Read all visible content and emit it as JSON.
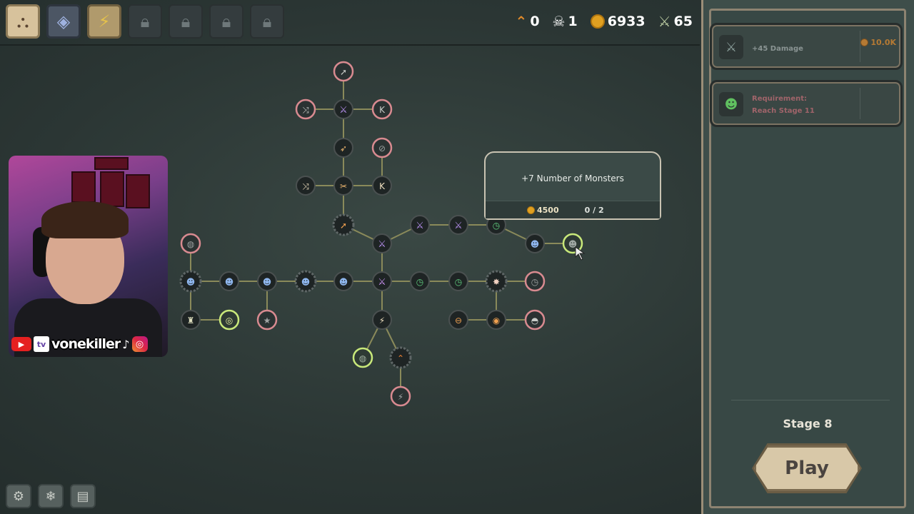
{
  "tabs": [
    {
      "name": "skill-tree-tab",
      "icon": "tree-icon",
      "state": "active"
    },
    {
      "name": "crystal-tab",
      "icon": "crystal-icon",
      "state": "unlocked"
    },
    {
      "name": "bolt-tab",
      "icon": "lightning-icon",
      "state": "unlocked"
    },
    {
      "name": "locked-tab-1",
      "icon": "lock-icon",
      "state": "locked"
    },
    {
      "name": "locked-tab-2",
      "icon": "lock-icon",
      "state": "locked"
    },
    {
      "name": "locked-tab-3",
      "icon": "lock-icon",
      "state": "locked"
    },
    {
      "name": "locked-tab-4",
      "icon": "lock-icon",
      "state": "locked"
    }
  ],
  "resources": {
    "rank": "0",
    "skulls": "1",
    "gold": "6933",
    "power": "65"
  },
  "tooltip": {
    "title": "+7 Number of Monsters",
    "cost": "4500",
    "progress": "0 / 2"
  },
  "webcam": {
    "handle": "vonekiller"
  },
  "panel": {
    "upgrade_card": {
      "text": "+45 Damage",
      "cost": "10.0K"
    },
    "requirement_card": {
      "line1": "Requirement:",
      "line2": "Reach Stage 11"
    },
    "stage": "Stage 8",
    "play_label": "Play"
  },
  "colors": {
    "background": "#2b3634",
    "ring_pink": "#d88a90",
    "ring_lime": "#c8e87a",
    "link": "#8a8a5a",
    "gold": "#e0a021"
  }
}
